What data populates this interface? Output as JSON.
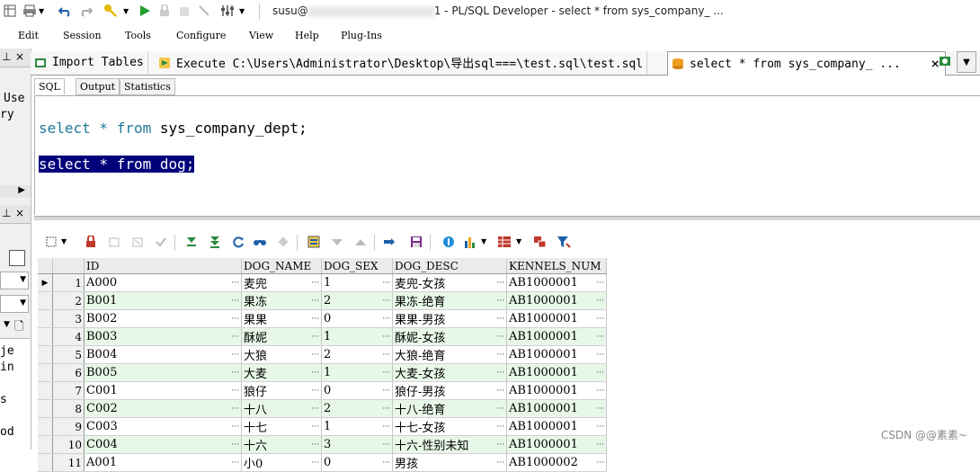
{
  "window": {
    "title_prefix": "susu@",
    "title_suffix": "1 - PL/SQL Developer - select * from sys_company_ ..."
  },
  "menu": [
    "Edit",
    "Session",
    "Tools",
    "Configure",
    "View",
    "Help",
    "Plug-Ins"
  ],
  "left_dock_fragments": [
    "Use",
    "ry",
    "je",
    "in",
    "s",
    "od"
  ],
  "tabs": [
    {
      "label": "Import Tables",
      "icon": "table-import-icon"
    },
    {
      "label": "Execute C:\\Users\\Administrator\\Desktop\\导出sql===\\test.sql\\test.sql",
      "icon": "script-execute-icon"
    },
    {
      "label": "select * from sys_company_ ...",
      "icon": "sql-window-icon",
      "active": true
    }
  ],
  "sub_tabs": [
    "SQL",
    "Output",
    "Statistics"
  ],
  "editor": {
    "line1": {
      "kw1": "select",
      "op": " * ",
      "kw2": "from",
      "rest": " sys_company_dept;"
    },
    "line2": {
      "text": "select * from dog;"
    }
  },
  "grid": {
    "columns": [
      "ID",
      "DOG_NAME",
      "DOG_SEX",
      "DOG_DESC",
      "KENNELS_NUM"
    ],
    "rows": [
      [
        "1",
        "A000",
        "麦兜",
        "1",
        "麦兜-女孩",
        "AB1000001"
      ],
      [
        "2",
        "B001",
        "果冻",
        "2",
        "果冻-绝育",
        "AB1000001"
      ],
      [
        "3",
        "B002",
        "果果",
        "0",
        "果果-男孩",
        "AB1000001"
      ],
      [
        "4",
        "B003",
        "酥妮",
        "1",
        "酥妮-女孩",
        "AB1000001"
      ],
      [
        "5",
        "B004",
        "大狼",
        "2",
        "大狼-绝育",
        "AB1000001"
      ],
      [
        "6",
        "B005",
        "大麦",
        "1",
        "大麦-女孩",
        "AB1000001"
      ],
      [
        "7",
        "C001",
        "狼仔",
        "0",
        "狼仔-男孩",
        "AB1000001"
      ],
      [
        "8",
        "C002",
        "十八",
        "2",
        "十八-绝育",
        "AB1000001"
      ],
      [
        "9",
        "C003",
        "十七",
        "1",
        "十七-女孩",
        "AB1000001"
      ],
      [
        "10",
        "C004",
        "十六",
        "3",
        "十六-性别未知",
        "AB1000001"
      ],
      [
        "11",
        "A001",
        "小0",
        "0",
        "男孩",
        "AB1000002"
      ]
    ]
  },
  "watermark": "CSDN @@素素~"
}
